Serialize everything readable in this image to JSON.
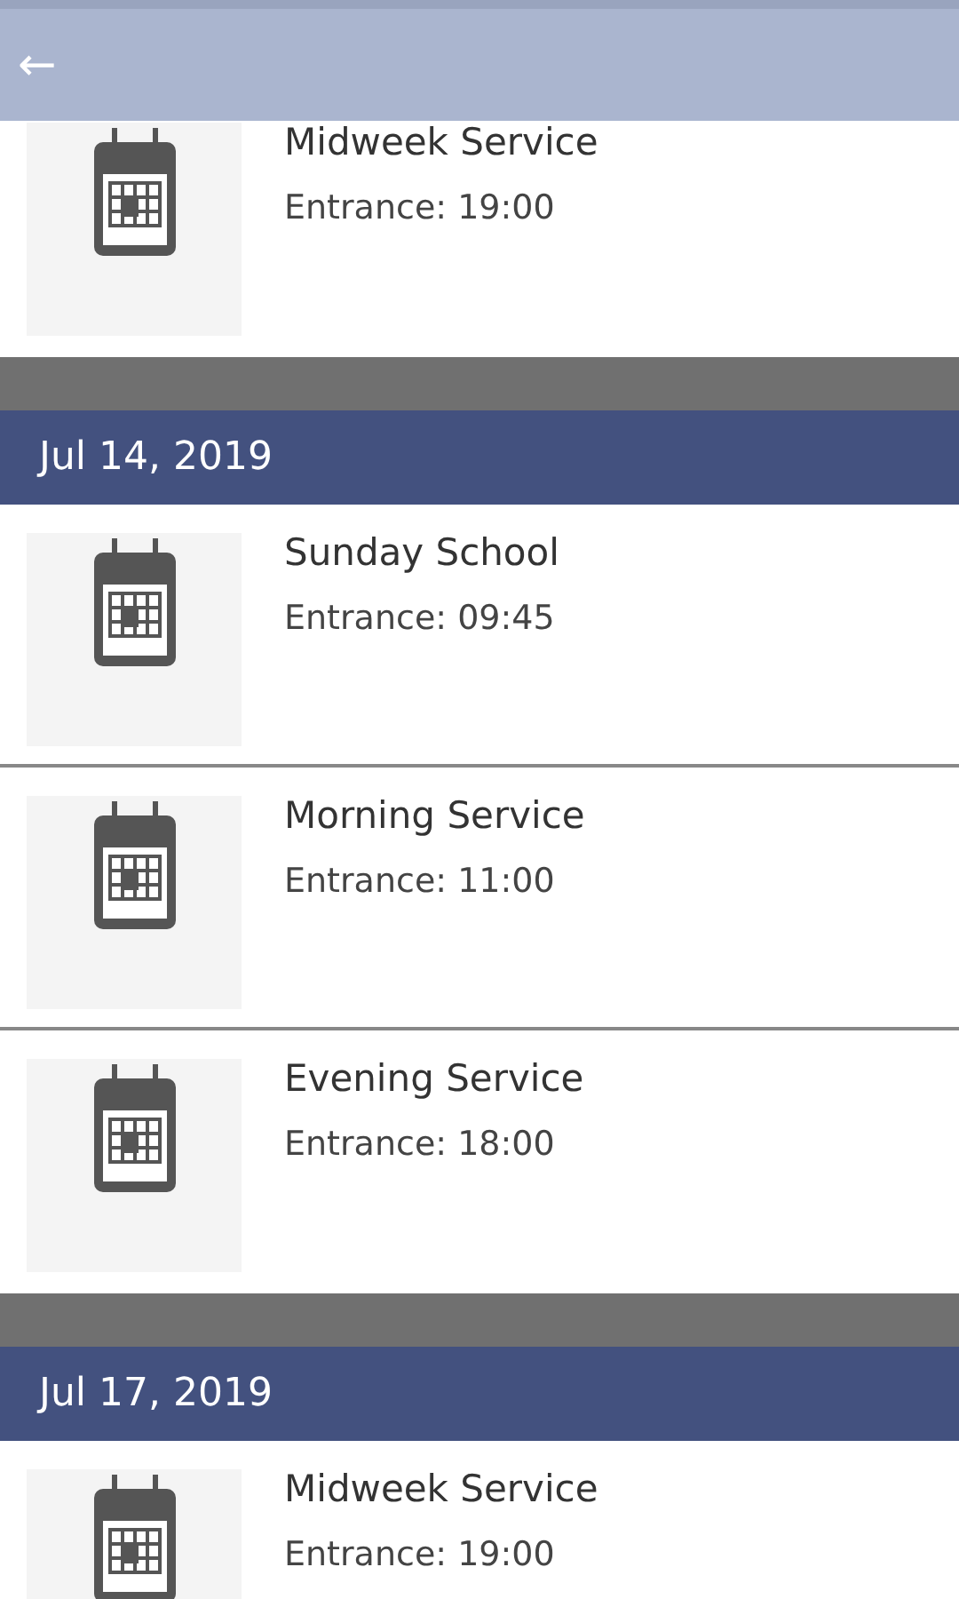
{
  "header": {
    "back": "←"
  },
  "sections": [
    {
      "events": [
        {
          "title": "Midweek Service",
          "entrance": "Entrance: 19:00"
        }
      ]
    },
    {
      "date": "Jul 14, 2019",
      "events": [
        {
          "title": "Sunday School",
          "entrance": "Entrance: 09:45"
        },
        {
          "title": "Morning Service",
          "entrance": "Entrance: 11:00"
        },
        {
          "title": "Evening Service",
          "entrance": "Entrance: 18:00"
        }
      ]
    },
    {
      "date": "Jul 17, 2019",
      "events": [
        {
          "title": "Midweek Service",
          "entrance": "Entrance: 19:00"
        }
      ]
    }
  ]
}
